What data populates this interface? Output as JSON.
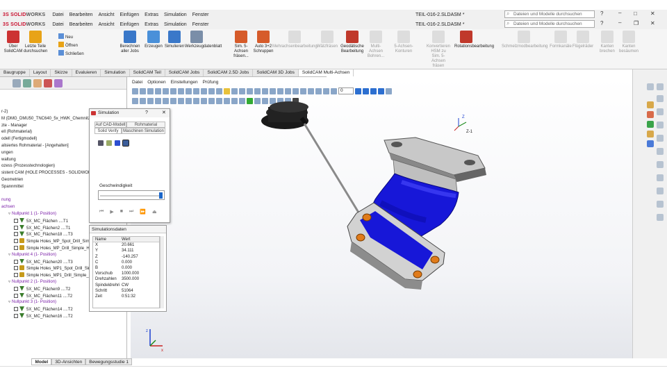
{
  "app": {
    "menu": [
      "Datei",
      "Bearbeiten",
      "Ansicht",
      "Einfügen",
      "Extras",
      "Simulation",
      "Fenster"
    ],
    "doc_title_1": "TEIL-016-2.SLDASM *",
    "doc_title_2": "TEIL-016-2.SLDASM *",
    "search_placeholder": "Dateien und Modelle durchsuchen",
    "accent": "#1b66c9"
  },
  "ribbon": {
    "buttons": [
      {
        "label": "Über SolidCAM",
        "color": "#c33"
      },
      {
        "label": "Letzte Teile durchsuchen",
        "color": "#e8a317"
      },
      {
        "label": "Neu",
        "color": "#5b8fd6"
      },
      {
        "label": "Öffnen",
        "color": "#e8a317"
      },
      {
        "label": "Schließen",
        "color": "#5b8fd6"
      },
      {
        "label": "Berechnen aller Jobs",
        "color": "#3a78c9"
      },
      {
        "label": "Erzeugen",
        "color": "#4a90d9"
      },
      {
        "label": "Simulieren",
        "color": "#3a78c9"
      },
      {
        "label": "Werkzeugdatenblatt",
        "color": "#7a8ea8"
      },
      {
        "label": "Sim. 5-Achsen fräsen...",
        "color": "#d65b2a"
      },
      {
        "label": "Auto 3+2 Schruppen",
        "color": "#d65b2a"
      },
      {
        "label": "Geodätische Bearbeitung",
        "color": "#c0392b"
      },
      {
        "label": "Rotationsbearbeitung",
        "color": "#c0392b"
      }
    ],
    "dim_buttons": [
      "Mehrachsenbearbeitung",
      "Wälzfräsen",
      "Multi-Achsen Bohren...",
      "5-Achsen-Konturen",
      "Konvertieren HSM zu Sim. 5-Achsen fräsen",
      "Schmelzmodbearbeitung",
      "Formkanäle",
      "Flügelräder",
      "Kanten brechen",
      "Kanten besäumen"
    ]
  },
  "tabs": [
    "Baugruppe",
    "Layout",
    "Skizze",
    "Evaluieren",
    "Simulation",
    "SolidCAM Teil",
    "SolidCAM Jobs",
    "SolidCAM 2.5D Jobs",
    "SolidCAM 3D Jobs",
    "SolidCAM Multi-Achsen"
  ],
  "active_tab": "SolidCAM Multi-Achsen",
  "viewport": {
    "menu": [
      "Datei",
      "Optionen",
      "Einstellungen",
      "Prüfung"
    ],
    "counter": "0",
    "view_label": "Z-1"
  },
  "tree": {
    "rows": [
      {
        "text": "r-2)",
        "style": ""
      },
      {
        "text": "M (DMG_DMU50_TNC640_5x_HWK_Chemnitz)",
        "style": ""
      },
      {
        "text": "zte - Manager",
        "style": ""
      },
      {
        "text": "ell (Rohmaterial)",
        "style": ""
      },
      {
        "text": "odell (Fertigmodell)",
        "style": ""
      },
      {
        "text": "alisiertes Rohmaterial - [Angehalten]",
        "style": ""
      },
      {
        "text": "ungen",
        "style": ""
      },
      {
        "text": "waltung",
        "style": ""
      },
      {
        "text": "ozess (Prozesstechnologien)",
        "style": ""
      },
      {
        "text": "sistent CAM (HOLE PROCESSES - SOLIDWORKS C",
        "style": ""
      },
      {
        "text": "Geometrien",
        "style": ""
      },
      {
        "text": "Spannmittel",
        "style": ""
      },
      {
        "text": "",
        "style": ""
      },
      {
        "text": "nung",
        "style": "purple"
      },
      {
        "text": "achsen",
        "style": "purple"
      },
      {
        "text": "Nullpunkt 1 (1- Position)",
        "style": "purple"
      },
      {
        "text": "5X_MC_Flächen ....T1",
        "style": "op"
      },
      {
        "text": "5X_MC_Flächen2 ....T1",
        "style": "op"
      },
      {
        "text": "5X_MC_Flächen18 ....T3",
        "style": "op"
      },
      {
        "text": "Simple Holes_MP_Spot_Drill_Simple_H",
        "style": "hole"
      },
      {
        "text": "Simple Holes_MP_Drill_Simple_Holes",
        "style": "hole"
      },
      {
        "text": "Nullpunkt 4 (1- Position)",
        "style": "purple"
      },
      {
        "text": "5X_MC_Flächen20 ....T3",
        "style": "op"
      },
      {
        "text": "Simple Holes_MP1_Spot_Drill_Simple_",
        "style": "hole"
      },
      {
        "text": "Simple Holes_MP1_Drill_Simple_Holes",
        "style": "hole"
      },
      {
        "text": "Nullpunkt 2 (1- Position)",
        "style": "purple"
      },
      {
        "text": "5X_MC_Flächen9 ....T2",
        "style": "op"
      },
      {
        "text": "5X_MC_Flächen11 ....T2",
        "style": "op"
      },
      {
        "text": "Nullpunkt 3 (1- Position)",
        "style": "purple"
      },
      {
        "text": "5X_MC_Flächen14 ....T2",
        "style": "op"
      },
      {
        "text": "5X_MC_Flächen16 ....T2",
        "style": "op"
      }
    ]
  },
  "simulation": {
    "title": "Simulation",
    "help": "?",
    "tabs": [
      "Auf CAD-Modell",
      "Rohmaterial anzeigen",
      "Solid Verify",
      "Maschinen Simulation"
    ],
    "speed_label": "Geschwindigkeit",
    "speed_fraction": 0.95
  },
  "simdata": {
    "title": "Simulationsdaten",
    "col_name": "Name",
    "col_value": "Wert",
    "rows": [
      [
        "X",
        "20.661"
      ],
      [
        "Y",
        "34.111"
      ],
      [
        "Z",
        "-140.257"
      ],
      [
        "C",
        "0.000"
      ],
      [
        "B",
        "0.000"
      ],
      [
        "Vorschub",
        "1000.000"
      ],
      [
        "Drehzahlen",
        "3500.000"
      ],
      [
        "Spindeldrehric...",
        "CW"
      ],
      [
        "Schritt",
        "51064"
      ],
      [
        "Zeit",
        "0:51:32"
      ]
    ]
  },
  "bottom_tabs": [
    "Model",
    "3D-Ansichten",
    "Bewegungsstudie 1"
  ]
}
